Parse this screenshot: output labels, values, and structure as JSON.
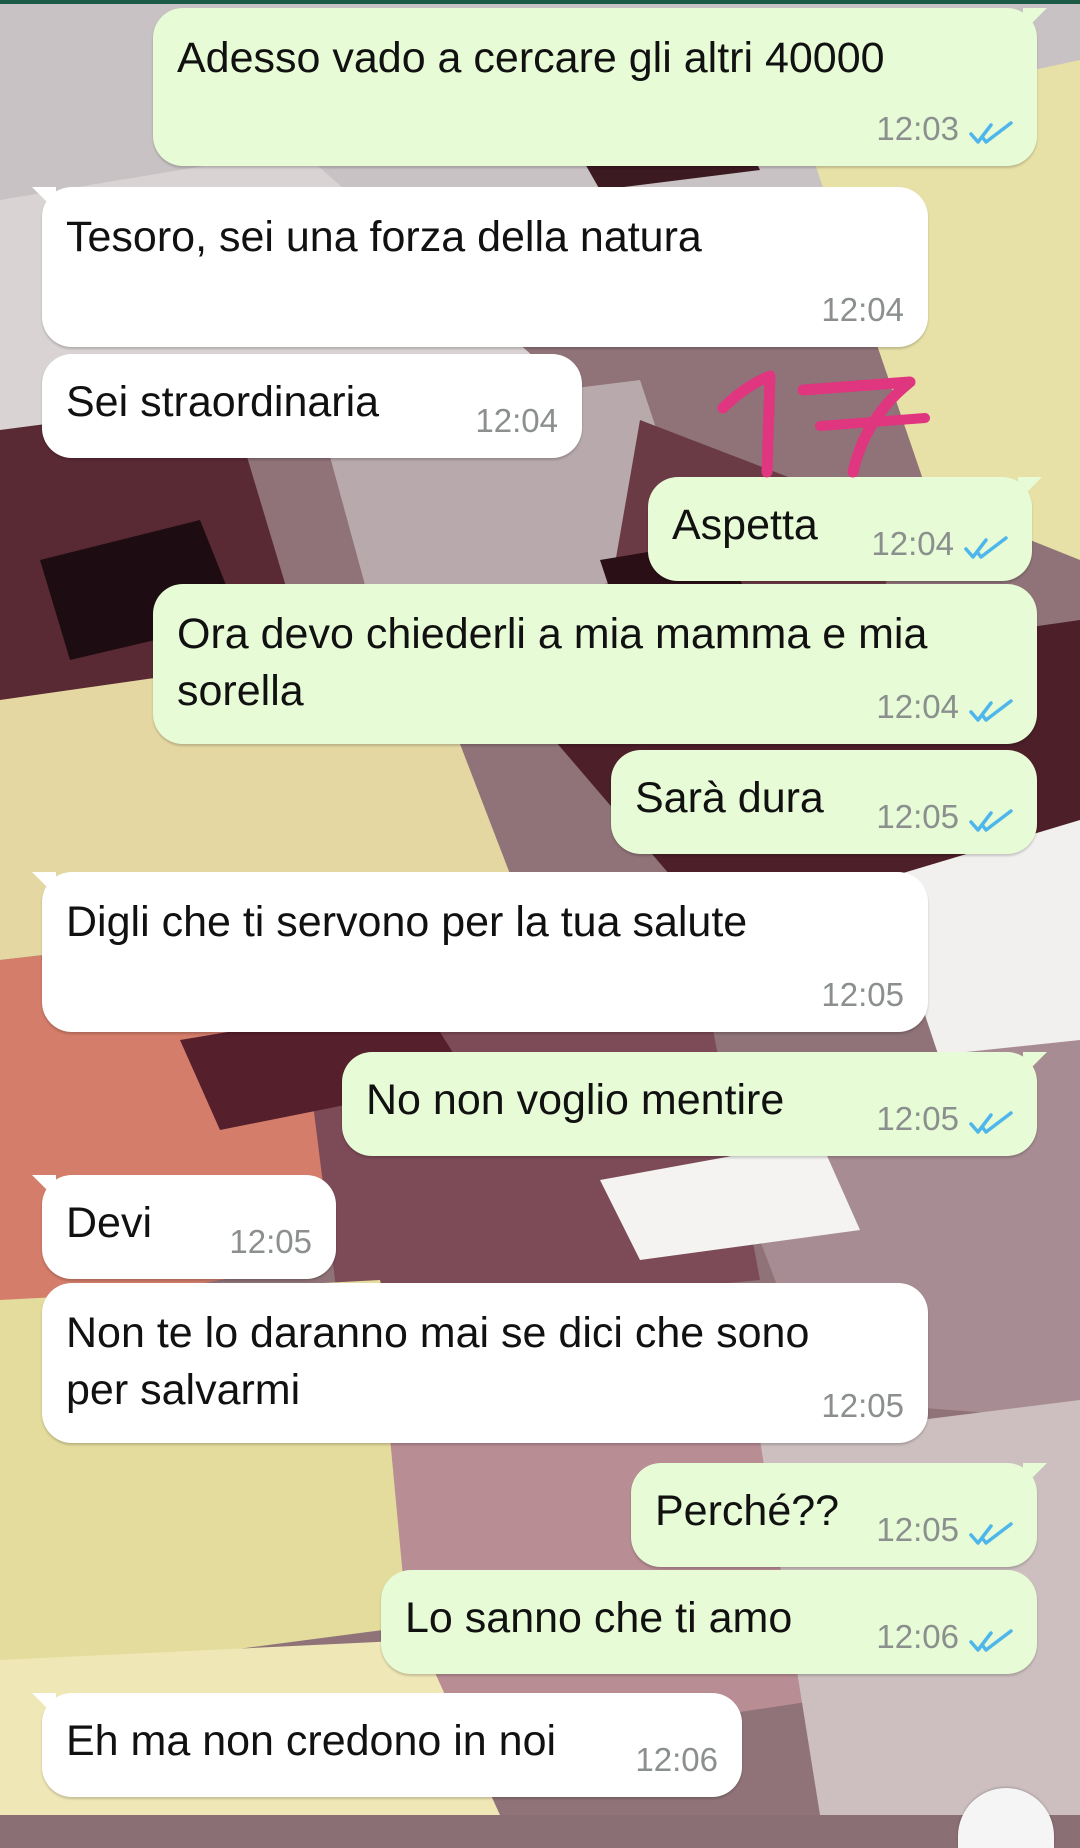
{
  "chat": {
    "messages": [
      {
        "direction": "out",
        "text": "Adesso vado a cercare gli altri 40000",
        "time": "12:03",
        "read": true
      },
      {
        "direction": "in",
        "text": "Tesoro, sei una forza della natura",
        "time": "12:04"
      },
      {
        "direction": "in",
        "text": "Sei straordinaria",
        "time": "12:04"
      },
      {
        "direction": "out",
        "text": "Aspetta",
        "time": "12:04",
        "read": true
      },
      {
        "direction": "out",
        "text": "Ora devo chiederli a mia mamma e mia\nsorella",
        "time": "12:04",
        "read": true
      },
      {
        "direction": "out",
        "text": "Sarà dura",
        "time": "12:05",
        "read": true
      },
      {
        "direction": "in",
        "text": "Digli che ti servono per la tua salute",
        "time": "12:05"
      },
      {
        "direction": "out",
        "text": "No non voglio mentire",
        "time": "12:05",
        "read": true
      },
      {
        "direction": "in",
        "text": "Devi",
        "time": "12:05"
      },
      {
        "direction": "in",
        "text": "Non te lo daranno mai se dici che sono\nper salvarmi",
        "time": "12:05"
      },
      {
        "direction": "out",
        "text": "Perché??",
        "time": "12:05",
        "read": true
      },
      {
        "direction": "out",
        "text": "Lo sanno che ti amo",
        "time": "12:06",
        "read": true
      },
      {
        "direction": "in",
        "text": "Eh ma non credono in noi",
        "time": "12:06"
      }
    ]
  },
  "annotation": {
    "text": "17",
    "color": "#e0357f"
  },
  "theme": {
    "outgoing_bubble": "#e6fbd6",
    "incoming_bubble": "#ffffff",
    "read_tick_color": "#4fb6ec",
    "timestamp_color": "#8b8f8e"
  },
  "icons": {
    "read_receipt": "double-check-icon"
  }
}
